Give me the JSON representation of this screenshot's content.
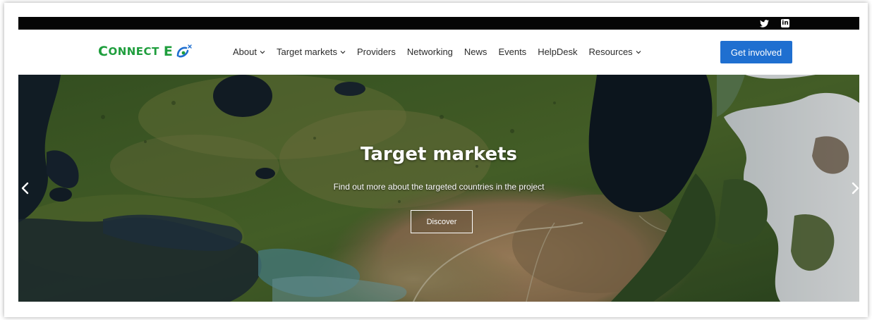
{
  "social": {
    "icons": [
      "twitter-icon",
      "linkedin-icon"
    ],
    "linkedin_glyph": "in"
  },
  "logo": {
    "word1_initial": "C",
    "word1_rest": "ONNECT",
    "word2": "E",
    "mark_icon": "eo-globe-icon"
  },
  "nav": {
    "items": [
      {
        "label": "About",
        "dropdown": true
      },
      {
        "label": "Target markets",
        "dropdown": true
      },
      {
        "label": "Providers",
        "dropdown": false
      },
      {
        "label": "Networking",
        "dropdown": false
      },
      {
        "label": "News",
        "dropdown": false
      },
      {
        "label": "Events",
        "dropdown": false
      },
      {
        "label": "HelpDesk",
        "dropdown": false
      },
      {
        "label": "Resources",
        "dropdown": true
      }
    ],
    "cta_label": "Get involved"
  },
  "hero": {
    "title": "Target markets",
    "subtitle": "Find out more about the targeted countries in the project",
    "button_label": "Discover",
    "prev_icon": "chevron-left-icon",
    "next_icon": "chevron-right-icon"
  },
  "colors": {
    "brand_green": "#1f9e3d",
    "cta_blue": "#1f6fd0",
    "topbar": "#050505"
  }
}
